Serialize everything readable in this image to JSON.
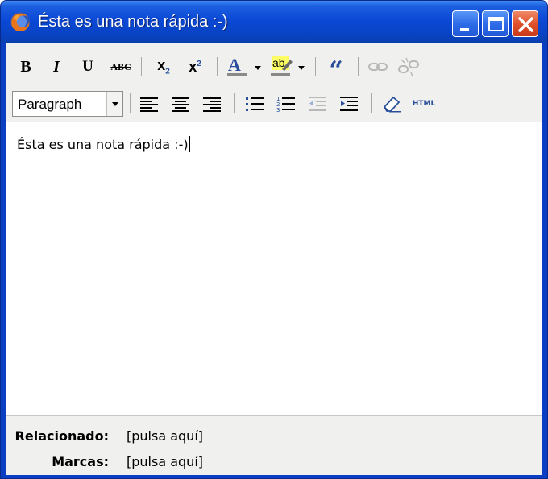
{
  "window": {
    "title": "Ésta es una nota rápida :-)",
    "app_icon": "firefox-icon",
    "controls": [
      "minimize-icon",
      "maximize-icon",
      "close-icon"
    ]
  },
  "toolbar": {
    "row1": [
      {
        "name": "bold-button",
        "icon": "B"
      },
      {
        "name": "italic-button",
        "icon": "I"
      },
      {
        "name": "underline-button",
        "icon": "U"
      },
      {
        "name": "strikethrough-button",
        "icon": "ABC"
      },
      {
        "name": "subscript-button",
        "icon": "x2-sub"
      },
      {
        "name": "superscript-button",
        "icon": "x2-sup"
      },
      {
        "name": "text-color-button",
        "icon": "A"
      },
      {
        "name": "highlight-color-button",
        "icon": "ab"
      },
      {
        "name": "blockquote-button",
        "icon": "quote-icon"
      },
      {
        "name": "link-button",
        "icon": "link-icon"
      },
      {
        "name": "unlink-button",
        "icon": "unlink-icon"
      }
    ],
    "format_select": {
      "value": "Paragraph"
    },
    "row2": [
      {
        "name": "align-left-button",
        "icon": "align-left-icon"
      },
      {
        "name": "align-center-button",
        "icon": "align-center-icon"
      },
      {
        "name": "align-right-button",
        "icon": "align-right-icon"
      },
      {
        "name": "bullet-list-button",
        "icon": "bullet-list-icon"
      },
      {
        "name": "numbered-list-button",
        "icon": "numbered-list-icon"
      },
      {
        "name": "outdent-button",
        "icon": "outdent-icon"
      },
      {
        "name": "indent-button",
        "icon": "indent-icon"
      },
      {
        "name": "clear-format-button",
        "icon": "eraser-icon"
      },
      {
        "name": "html-button",
        "icon": "HTML"
      }
    ],
    "glyphs": {
      "bold": "B",
      "italic": "I",
      "underline": "U",
      "strike": "ABC",
      "sub": "x",
      "sub_mark": "2",
      "sup": "x",
      "sup_mark": "2",
      "text_color": "A",
      "highlight": "ab",
      "quote": "“",
      "html": "HTML"
    },
    "colors": {
      "text_color_bar": "#8a8a8a",
      "highlight_bar": "#8a8a8a",
      "highlight_bg": "#ffff66",
      "icon_blue": "#2a4f9a"
    }
  },
  "editor": {
    "content": "Ésta es una nota rápida :-)"
  },
  "footer": {
    "related_label": "Relacionado:",
    "related_link": "[pulsa aquí]",
    "tags_label": "Marcas:",
    "tags_link": "[pulsa aquí]"
  },
  "colors": {
    "titlebar": "#0b49d6",
    "close_button": "#e0502a",
    "toolbar_bg": "#f0f0ee"
  }
}
